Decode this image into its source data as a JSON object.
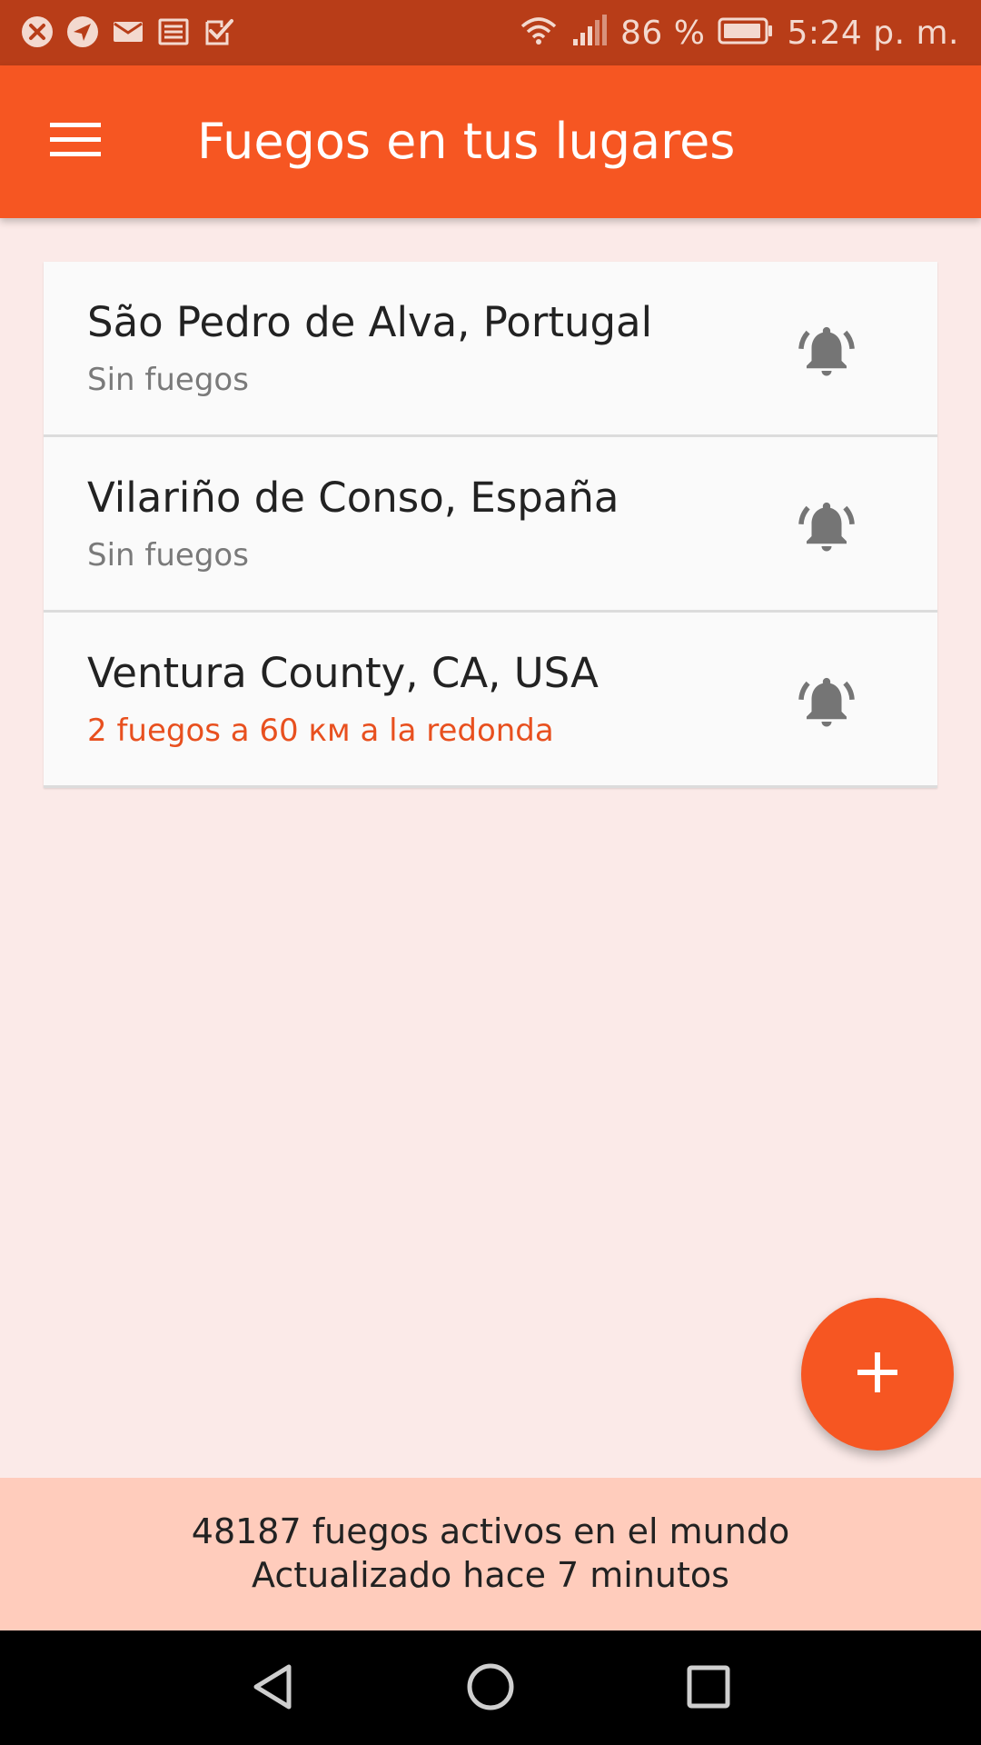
{
  "status_bar": {
    "battery_percent": "86 %",
    "time": "5:24 p. m.",
    "notification_icons": [
      "close-circle-icon",
      "navigation-icon",
      "mail-icon",
      "newspaper-icon",
      "check-box-icon"
    ]
  },
  "app_bar": {
    "title": "Fuegos en tus lugares"
  },
  "places": [
    {
      "name": "São Pedro de Alva, Portugal",
      "status": "Sin fuegos",
      "has_fires": false
    },
    {
      "name": "Vilariño de Conso, España",
      "status": "Sin fuegos",
      "has_fires": false
    },
    {
      "name": "Ventura County, CA, USA",
      "status": "2 fuegos a 60 км a la redonda",
      "has_fires": true
    }
  ],
  "footer": {
    "line1": "48187 fuegos activos en el mundo",
    "line2": "Actualizado hace 7 minutos"
  },
  "colors": {
    "status_bar": "#b83d18",
    "accent": "#f65622",
    "background": "#fbeae8",
    "footer": "#ffccbc",
    "alert_text": "#e8501f"
  }
}
